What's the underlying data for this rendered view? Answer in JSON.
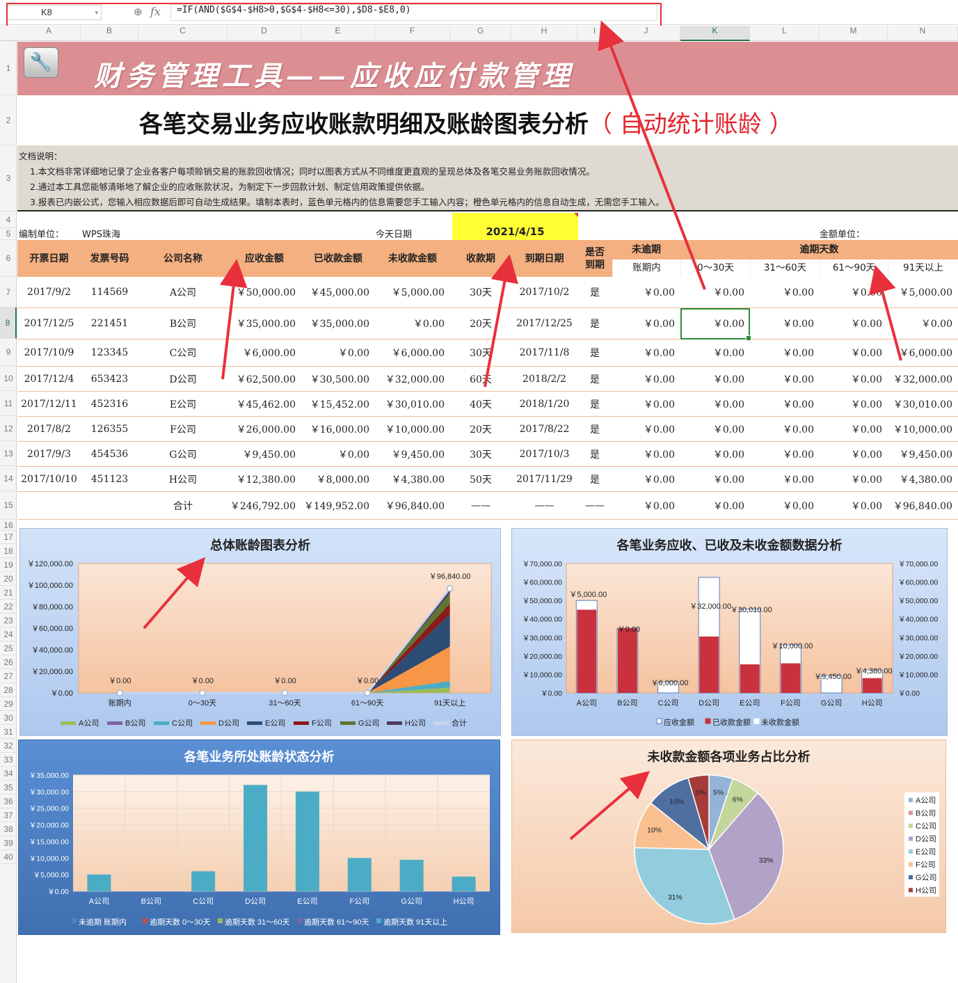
{
  "formula_bar": {
    "cell_ref": "K8",
    "formula": "=IF(AND($G$4-$H8>0,$G$4-$H8<=30),$D8-$E8,0)",
    "fx": "fx"
  },
  "columns": [
    "A",
    "B",
    "C",
    "D",
    "E",
    "F",
    "G",
    "H",
    "I",
    "J",
    "K",
    "L",
    "M",
    "N"
  ],
  "rows": [
    "1",
    "2",
    "3",
    "4",
    "5",
    "6",
    "7",
    "8",
    "9",
    "10",
    "11",
    "12",
    "13",
    "14",
    "15",
    "16",
    "17",
    "18",
    "19",
    "20",
    "21",
    "22",
    "23",
    "24",
    "25",
    "26",
    "27",
    "28",
    "29",
    "30",
    "31",
    "32",
    "33",
    "34",
    "35",
    "36",
    "37",
    "38",
    "39",
    "40"
  ],
  "app_title": "财务管理工具——应收应付款管理",
  "subtitle": {
    "main": "各笔交易业务应收账款明细及账龄图表分析",
    "red": "（ 自动统计账龄 ）"
  },
  "notes": [
    "文档说明：",
    "1.本文档非常详细地记录了企业各客户每项赊销交易的账款回收情况；同时以图表方式从不同维度更直观的呈现总体及各笔交易业务账款回收情况。",
    "2.通过本工具您能够清晰地了解企业的应收账款状况，为制定下一步回款计划、制定信用政策提供依据。",
    "3.报表已内嵌公式，您输入相应数据后即可自动生成结果。填制本表时，蓝色单元格内的信息需要您手工输入内容；橙色单元格内的信息自动生成，无需您手工输入。"
  ],
  "meta": {
    "unit_label": "编制单位：",
    "unit_value": "WPS珠海",
    "today_label": "今天日期",
    "today_value": "2021/4/15",
    "amount_label": "金额单位："
  },
  "headers": {
    "date": "开票日期",
    "invoice": "发票号码",
    "company": "公司名称",
    "receivable": "应收金额",
    "received": "已收款金额",
    "outstanding": "未收款金额",
    "term": "收款期",
    "due": "到期日期",
    "is_due": "是否到期",
    "not_overdue": "未逾期",
    "overdue_days": "逾期天数",
    "sub": [
      "账期内",
      "0～30天",
      "31～60天",
      "61～90天",
      "91天以上"
    ]
  },
  "table_rows": [
    [
      "2017/9/2",
      "114569",
      "A公司",
      "￥50,000.00",
      "￥45,000.00",
      "￥5,000.00",
      "30天",
      "2017/10/2",
      "是",
      "￥0.00",
      "￥0.00",
      "￥0.00",
      "￥0.00",
      "￥5,000.00"
    ],
    [
      "2017/12/5",
      "221451",
      "B公司",
      "￥35,000.00",
      "￥35,000.00",
      "￥0.00",
      "20天",
      "2017/12/25",
      "是",
      "￥0.00",
      "￥0.00",
      "￥0.00",
      "￥0.00",
      "￥0.00"
    ],
    [
      "2017/10/9",
      "123345",
      "C公司",
      "￥6,000.00",
      "￥0.00",
      "￥6,000.00",
      "30天",
      "2017/11/8",
      "是",
      "￥0.00",
      "￥0.00",
      "￥0.00",
      "￥0.00",
      "￥6,000.00"
    ],
    [
      "2017/12/4",
      "653423",
      "D公司",
      "￥62,500.00",
      "￥30,500.00",
      "￥32,000.00",
      "60天",
      "2018/2/2",
      "是",
      "￥0.00",
      "￥0.00",
      "￥0.00",
      "￥0.00",
      "￥32,000.00"
    ],
    [
      "2017/12/11",
      "452316",
      "E公司",
      "￥45,462.00",
      "￥15,452.00",
      "￥30,010.00",
      "40天",
      "2018/1/20",
      "是",
      "￥0.00",
      "￥0.00",
      "￥0.00",
      "￥0.00",
      "￥30,010.00"
    ],
    [
      "2017/8/2",
      "126355",
      "F公司",
      "￥26,000.00",
      "￥16,000.00",
      "￥10,000.00",
      "20天",
      "2017/8/22",
      "是",
      "￥0.00",
      "￥0.00",
      "￥0.00",
      "￥0.00",
      "￥10,000.00"
    ],
    [
      "2017/9/3",
      "454536",
      "G公司",
      "￥9,450.00",
      "￥0.00",
      "￥9,450.00",
      "30天",
      "2017/10/3",
      "是",
      "￥0.00",
      "￥0.00",
      "￥0.00",
      "￥0.00",
      "￥9,450.00"
    ],
    [
      "2017/10/10",
      "451123",
      "H公司",
      "￥12,380.00",
      "￥8,000.00",
      "￥4,380.00",
      "50天",
      "2017/11/29",
      "是",
      "￥0.00",
      "￥0.00",
      "￥0.00",
      "￥0.00",
      "￥4,380.00"
    ],
    [
      "",
      "",
      "合计",
      "￥246,792.00",
      "￥149,952.00",
      "￥96,840.00",
      "——",
      "——",
      "——",
      "￥0.00",
      "￥0.00",
      "￥0.00",
      "￥0.00",
      "￥96,840.00"
    ]
  ],
  "chart_data": [
    {
      "type": "area",
      "title": "总体账龄图表分析",
      "categories": [
        "账期内",
        "0～30天",
        "31～60天",
        "61～90天",
        "91天以上"
      ],
      "ylim": [
        0,
        120000
      ],
      "yticks": [
        "￥0.00",
        "￥20,000.00",
        "￥40,000.00",
        "￥60,000.00",
        "￥80,000.00",
        "￥100,000.00",
        "￥120,000.00"
      ],
      "series": [
        {
          "name": "A公司",
          "values": [
            0,
            0,
            0,
            0,
            5000
          ],
          "color": "#9bbb59"
        },
        {
          "name": "B公司",
          "values": [
            0,
            0,
            0,
            0,
            0
          ],
          "color": "#8064a2"
        },
        {
          "name": "C公司",
          "values": [
            0,
            0,
            0,
            0,
            6000
          ],
          "color": "#4bacc6"
        },
        {
          "name": "D公司",
          "values": [
            0,
            0,
            0,
            0,
            32000
          ],
          "color": "#f79646"
        },
        {
          "name": "E公司",
          "values": [
            0,
            0,
            0,
            0,
            30010
          ],
          "color": "#2c4d75"
        },
        {
          "name": "F公司",
          "values": [
            0,
            0,
            0,
            0,
            10000
          ],
          "color": "#8b1a1a"
        },
        {
          "name": "G公司",
          "values": [
            0,
            0,
            0,
            0,
            9450
          ],
          "color": "#5f7530"
        },
        {
          "name": "H公司",
          "values": [
            0,
            0,
            0,
            0,
            4380
          ],
          "color": "#4d3b62"
        }
      ],
      "total": {
        "name": "合计",
        "values": [
          0,
          0,
          0,
          0,
          96840
        ],
        "labels": [
          "￥0.00",
          "￥0.00",
          "￥0.00",
          "￥0.00",
          "￥96,840.00"
        ]
      }
    },
    {
      "type": "bar",
      "title": "各笔业务应收、已收及未收金额数据分析",
      "categories": [
        "A公司",
        "B公司",
        "C公司",
        "D公司",
        "E公司",
        "F公司",
        "G公司",
        "H公司"
      ],
      "ylim": [
        0,
        70000
      ],
      "yticks": [
        "￥0.00",
        "￥10,000.00",
        "￥20,000.00",
        "￥30,000.00",
        "￥40,000.00",
        "￥50,000.00",
        "￥60,000.00",
        "￥70,000.00"
      ],
      "series": [
        {
          "name": "应收金额",
          "values": [
            50000,
            35000,
            6000,
            62500,
            45462,
            26000,
            9450,
            12380
          ]
        },
        {
          "name": "已收款金额",
          "values": [
            45000,
            35000,
            0,
            30500,
            15452,
            16000,
            0,
            8000
          ]
        },
        {
          "name": "未收款金额",
          "values": [
            5000,
            0,
            6000,
            32000,
            30010,
            10000,
            9450,
            4380
          ]
        }
      ],
      "labels": [
        "￥5,000.00",
        "￥0.00",
        "￥6,000.00",
        "￥32,000.00",
        "￥30,010.00",
        "￥10,000.00",
        "￥9,450.00",
        "￥4,380.00"
      ]
    },
    {
      "type": "bar",
      "title": "各笔业务所处账龄状态分析",
      "categories": [
        "A公司",
        "B公司",
        "C公司",
        "D公司",
        "E公司",
        "F公司",
        "G公司",
        "H公司"
      ],
      "ylim": [
        0,
        35000
      ],
      "yticks": [
        "￥0.00",
        "￥5,000.00",
        "￥10,000.00",
        "￥15,000.00",
        "￥20,000.00",
        "￥25,000.00",
        "￥30,000.00",
        "￥35,000.00"
      ],
      "series": [
        {
          "name": "未逾期 账期内",
          "values": [
            0,
            0,
            0,
            0,
            0,
            0,
            0,
            0
          ],
          "color": "#4f81bd"
        },
        {
          "name": "逾期天数 0～30天",
          "values": [
            0,
            0,
            0,
            0,
            0,
            0,
            0,
            0
          ],
          "color": "#c0504d"
        },
        {
          "name": "逾期天数 31～60天",
          "values": [
            0,
            0,
            0,
            0,
            0,
            0,
            0,
            0
          ],
          "color": "#9bbb59"
        },
        {
          "name": "逾期天数 61～90天",
          "values": [
            0,
            0,
            0,
            0,
            0,
            0,
            0,
            0
          ],
          "color": "#8064a2"
        },
        {
          "name": "逾期天数 91天以上",
          "values": [
            5000,
            0,
            6000,
            32000,
            30010,
            10000,
            9450,
            4380
          ],
          "color": "#4bacc6"
        }
      ]
    },
    {
      "type": "pie",
      "title": "未收款金额各项业务占比分析",
      "labels": [
        "A公司",
        "B公司",
        "C公司",
        "D公司",
        "E公司",
        "F公司",
        "G公司",
        "H公司"
      ],
      "values": [
        5000,
        0,
        6000,
        32000,
        30010,
        10000,
        9450,
        4380
      ],
      "pct_labels": [
        "5%",
        "0%",
        "6%",
        "33%",
        "31%",
        "10%",
        "10%",
        "5%"
      ],
      "colors": [
        "#95b3d7",
        "#d99694",
        "#c3d69b",
        "#b3a2c7",
        "#93cddd",
        "#fac090",
        "#4f6fa0",
        "#a63c3a"
      ]
    }
  ]
}
